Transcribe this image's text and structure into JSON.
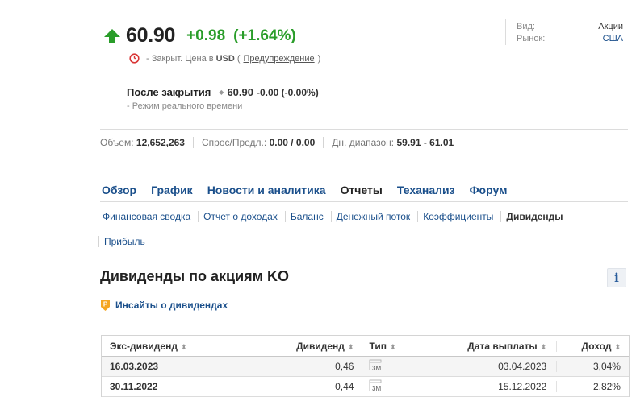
{
  "quote": {
    "price": "60.90",
    "change": "+0.98",
    "change_pct": "(+1.64%)",
    "status_prefix": "- Закрыт. Цена в",
    "currency": "USD",
    "warning_link": "Предупреждение",
    "paren_open": "(",
    "paren_close": ")"
  },
  "after_hours": {
    "label": "После закрытия",
    "price": "60.90",
    "change": "-0.00 (-0.00%)",
    "note": "- Режим реального времени"
  },
  "info": {
    "type_label": "Вид:",
    "type_value": "Акции",
    "market_label": "Рынок:",
    "market_value": "США"
  },
  "stats": {
    "volume_label": "Объем:",
    "volume_value": "12,652,263",
    "bidask_label": "Спрос/Предл.:",
    "bidask_value": "0.00 / 0.00",
    "range_label": "Дн. диапазон:",
    "range_value": "59.91 - 61.01"
  },
  "tabs": [
    "Обзор",
    "График",
    "Новости и аналитика",
    "Отчеты",
    "Теханализ",
    "Форум"
  ],
  "active_tab": "Отчеты",
  "subtabs": [
    "Финансовая сводка",
    "Отчет о доходах",
    "Баланс",
    "Денежный поток",
    "Коэффициенты",
    "Дивиденды",
    "Прибыль"
  ],
  "active_subtab": "Дивиденды",
  "section": {
    "title": "Дивиденды по акциям KO",
    "info_glyph": "i",
    "insights_label": "Инсайты о дивидендах"
  },
  "table": {
    "headers": [
      "Экс-дивиденд",
      "Дивиденд",
      "Тип",
      "Дата выплаты",
      "Доход"
    ],
    "sort_glyph": "⬍",
    "rows": [
      {
        "ex_date": "16.03.2023",
        "dividend": "0,46",
        "type": "3M",
        "pay_date": "03.04.2023",
        "yield": "3,04%"
      },
      {
        "ex_date": "30.11.2022",
        "dividend": "0,44",
        "type": "3M",
        "pay_date": "15.12.2022",
        "yield": "2,82%"
      }
    ]
  },
  "colors": {
    "positive": "#2a9d2a",
    "link": "#1a4f8b",
    "warning_clock": "#d93535",
    "pro_icon": "#f5a623"
  }
}
